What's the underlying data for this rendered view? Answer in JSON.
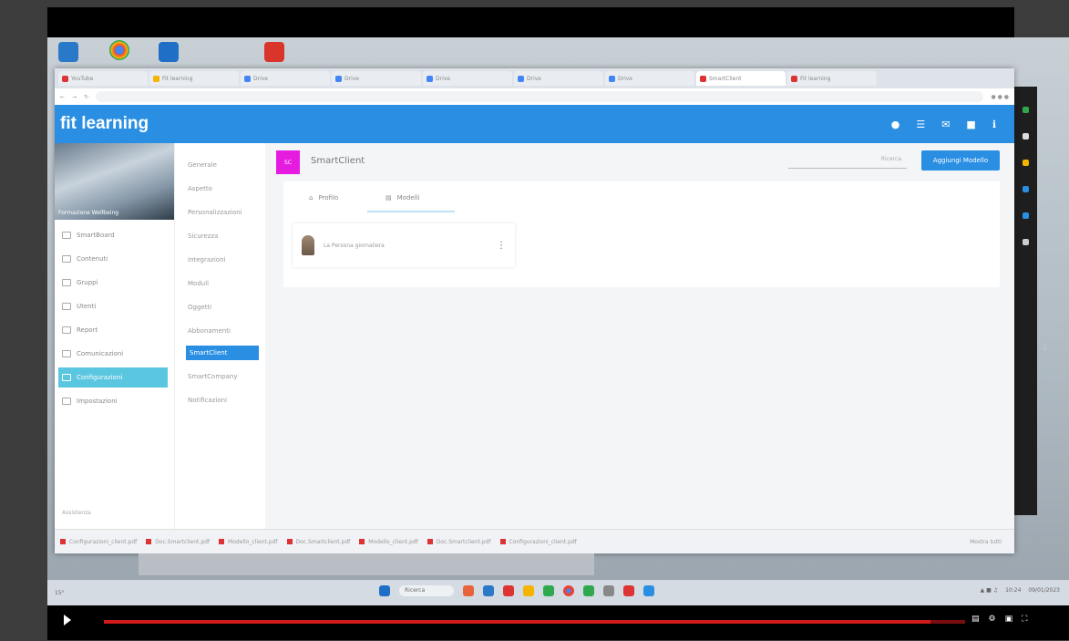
{
  "app": {
    "brand": "fit learning",
    "hero_caption": "Formazione Wellbeing"
  },
  "browser": {
    "tabs": [
      {
        "label": "YouTube",
        "color": "#d33"
      },
      {
        "label": "Fit learning",
        "color": "#f4b400"
      },
      {
        "label": "Drive",
        "color": "#4285f4"
      },
      {
        "label": "Drive",
        "color": "#4285f4"
      },
      {
        "label": "Drive",
        "color": "#4285f4"
      },
      {
        "label": "Drive",
        "color": "#4285f4"
      },
      {
        "label": "Drive",
        "color": "#4285f4"
      },
      {
        "label": "SmartClient",
        "color": "#d33"
      },
      {
        "label": "Fit learning",
        "color": "#d33"
      }
    ],
    "active_tab_index": 7
  },
  "sidebar": {
    "items": [
      {
        "label": "SmartBoard"
      },
      {
        "label": "Contenuti"
      },
      {
        "label": "Gruppi"
      },
      {
        "label": "Utenti"
      },
      {
        "label": "Report"
      },
      {
        "label": "Comunicazioni"
      },
      {
        "label": "Configurazioni",
        "selected": true
      },
      {
        "label": "Impostazioni"
      }
    ],
    "footer": "Assistenza"
  },
  "submenu": {
    "items": [
      {
        "label": "Generale"
      },
      {
        "label": "Aspetto"
      },
      {
        "label": "Personalizzazioni"
      },
      {
        "label": "Sicurezza"
      },
      {
        "label": "Integrazioni"
      },
      {
        "label": "Moduli"
      },
      {
        "label": "Oggetti"
      },
      {
        "label": "Abbonamenti"
      },
      {
        "label": "SmartClient",
        "selected": true
      },
      {
        "label": "SmartCompany"
      },
      {
        "label": "Notificazioni"
      }
    ]
  },
  "content": {
    "logo_text": "SC",
    "title": "SmartClient",
    "search_placeholder": "Ricerca",
    "add_button": "Aggiungi Modello",
    "tabs": [
      {
        "label": "Profilo",
        "icon": "home-icon"
      },
      {
        "label": "Modelli",
        "icon": "file-icon",
        "active": true
      }
    ],
    "items": [
      {
        "name": "La Persona giornaliera",
        "avatar": "statue-figure"
      }
    ]
  },
  "status_bar": {
    "downloads": [
      "Configurazioni_client.pdf",
      "Doc.Smartclient.pdf",
      "Modello_client.pdf",
      "Doc.Smartclient.pdf",
      "Modello_client.pdf",
      "Doc.Smartclient.pdf",
      "Configurazioni_client.pdf"
    ],
    "show_all": "Mostra tutti"
  },
  "taskbar": {
    "weather": "15°",
    "search": "Ricerca",
    "time": "10:24",
    "date": "09/01/2023"
  },
  "player": {
    "progress": 0.96
  }
}
